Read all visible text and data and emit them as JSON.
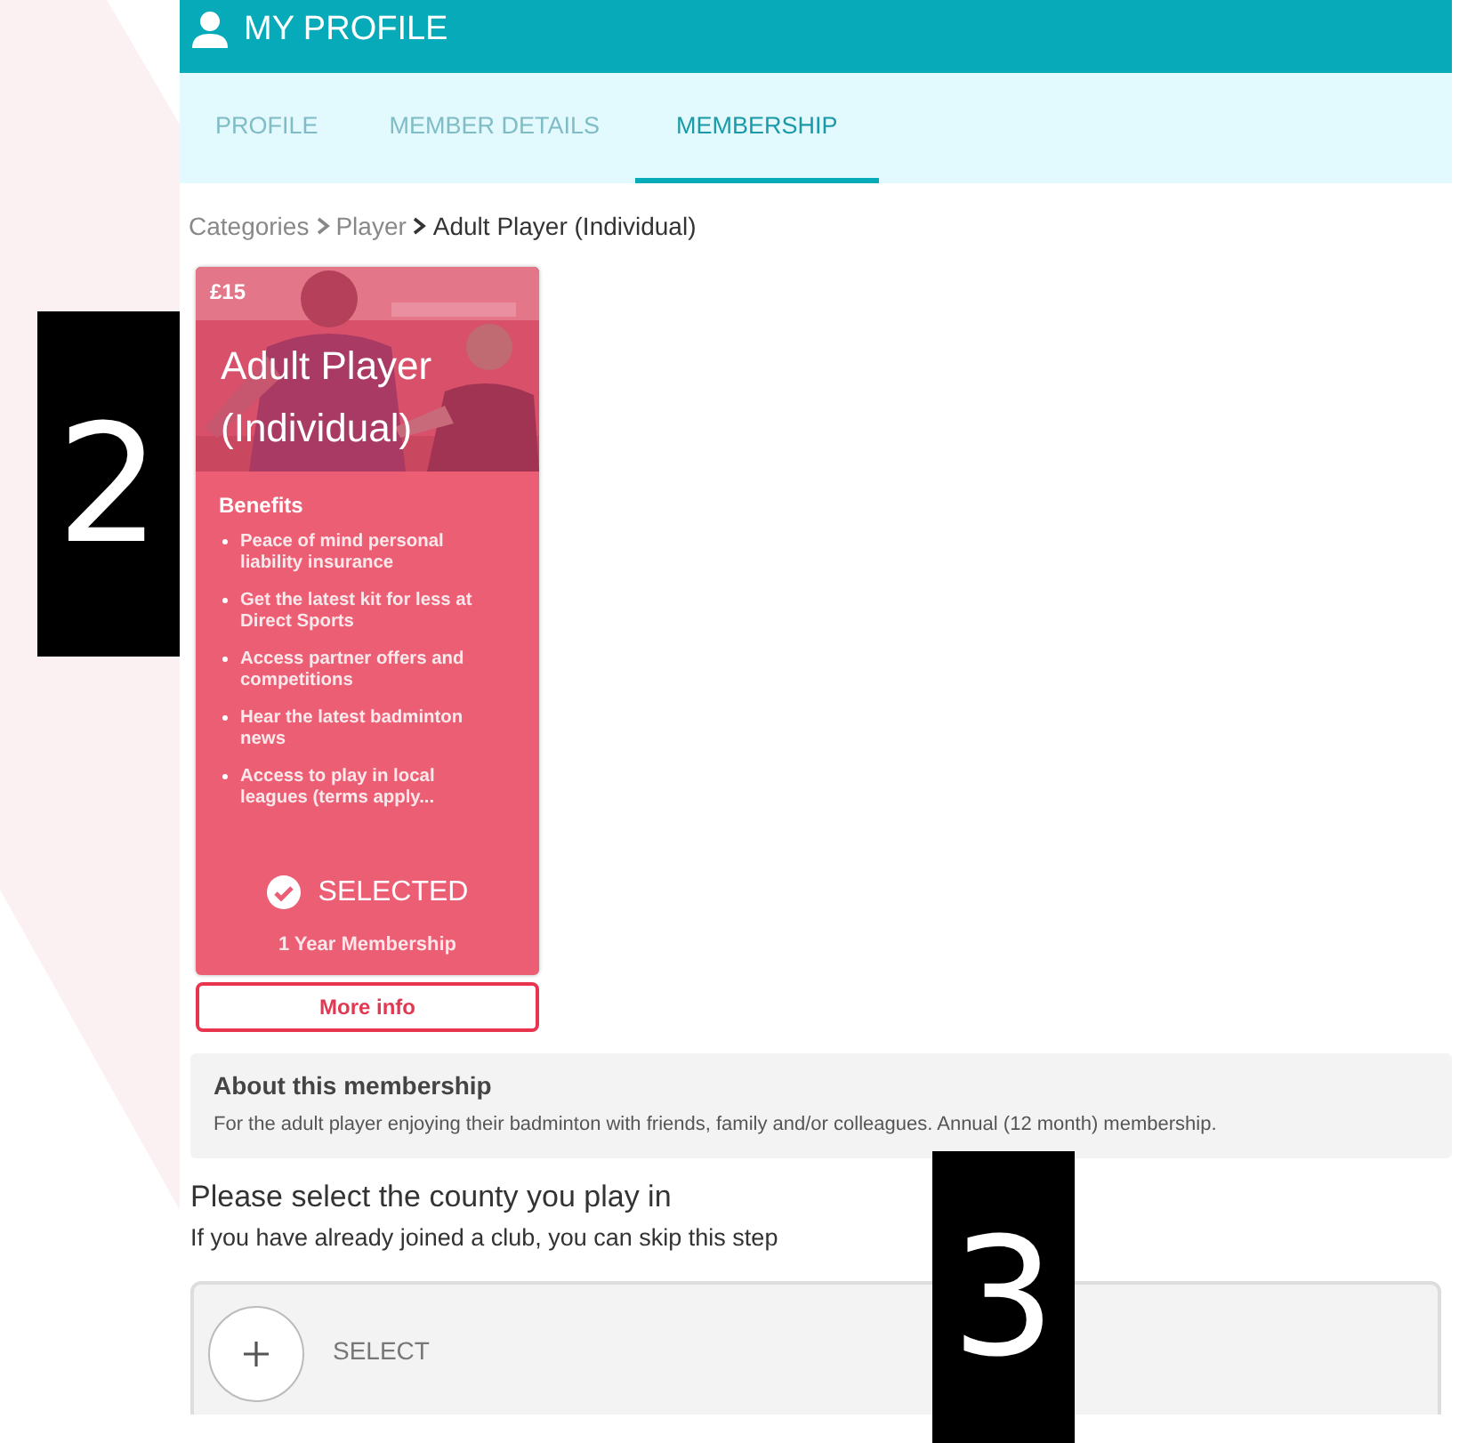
{
  "header": {
    "title": "MY PROFILE"
  },
  "tabs": [
    {
      "label": "PROFILE",
      "selected": false
    },
    {
      "label": "MEMBER DETAILS",
      "selected": false
    },
    {
      "label": "MEMBERSHIP",
      "selected": true
    }
  ],
  "breadcrumb": [
    {
      "label": "Categories",
      "current": false
    },
    {
      "label": "Player",
      "current": false
    },
    {
      "label": "Adult Player (Individual)",
      "current": true
    }
  ],
  "card": {
    "price": "£15",
    "title": "Adult Player (Individual)",
    "benefits_heading": "Benefits",
    "benefits": [
      "Peace of mind personal liability insurance",
      "Get the latest kit for less at Direct Sports",
      "Access partner offers and competitions",
      "Hear the latest badminton news",
      "Access to play in local leagues (terms apply..."
    ],
    "selected": true,
    "status": "SELECTED",
    "term": "1 Year Membership",
    "more_info": "More info"
  },
  "about": {
    "title": "About this membership",
    "text": "For the adult player enjoying their badminton with friends, family and/or colleagues. Annual (12 month) membership."
  },
  "county": {
    "heading": "Please select the county you play in",
    "subheading": "If you have already joined a club, you can skip this step",
    "select": {
      "label": "SELECT"
    }
  },
  "callouts": [
    {
      "label": "2"
    },
    {
      "label": "3"
    }
  ]
}
